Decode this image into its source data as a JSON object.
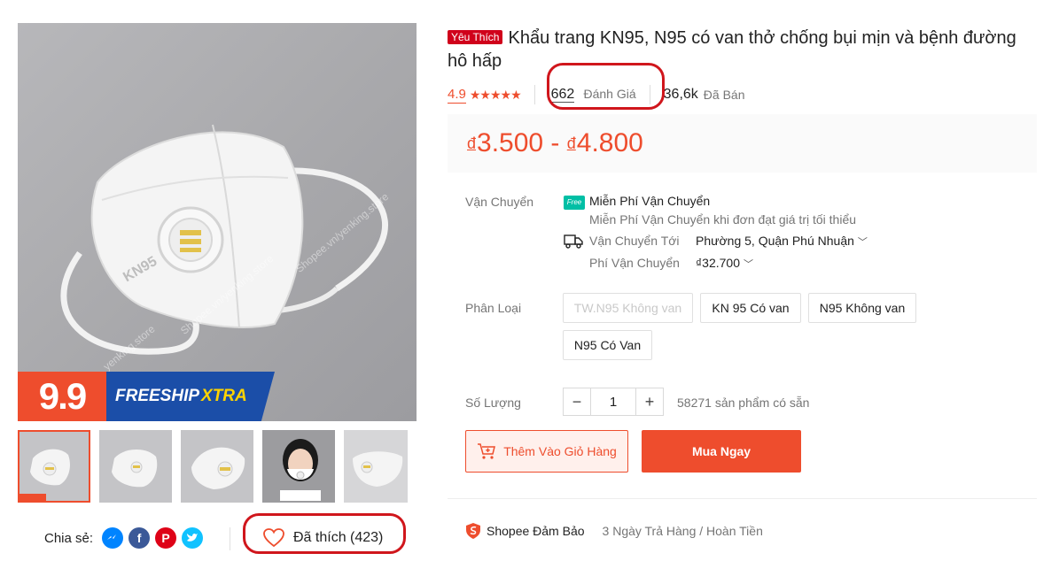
{
  "gallery": {
    "watermark": "Shopee.vn/yenking.store",
    "watermark_2": "yenking.store",
    "mask_text": "KN95",
    "promo": {
      "big": "9.9",
      "freeship": "FREESHIP",
      "xtra": "XTRA"
    },
    "thumbnails": [
      "thumb-1",
      "thumb-2",
      "thumb-3",
      "thumb-4",
      "thumb-5"
    ]
  },
  "share": {
    "label": "Chia sẻ:",
    "icons": [
      "messenger-icon",
      "facebook-icon",
      "pinterest-icon",
      "twitter-icon"
    ]
  },
  "like": {
    "label": "Đã thích (423)"
  },
  "product": {
    "badge": "Yêu Thích",
    "title": "Khẩu trang KN95, N95 có van thở chống bụi mịn và bệnh đường hô hấp",
    "rating": "4.9",
    "stars": "★★★★★",
    "review_count": "662",
    "review_label": "Đánh Giá",
    "sold_count": "36,6k",
    "sold_label": "Đã Bán",
    "price_currency": "đ",
    "price_min": "3.500",
    "price_dash": " - ",
    "price_max": "4.800"
  },
  "shipping": {
    "label": "Vận Chuyển",
    "free_badge": "Free",
    "free_title": "Miễn Phí Vận Chuyển",
    "free_sub": "Miễn Phí Vận Chuyển khi đơn đạt giá trị tối thiểu",
    "to_label": "Vận Chuyển Tới",
    "to_value": "Phường 5, Quận Phú Nhuận",
    "fee_label": "Phí Vận Chuyển",
    "fee_value": "₫32.700"
  },
  "variants": {
    "label": "Phân Loại",
    "options": [
      {
        "label": "TW.N95 Không van",
        "disabled": true
      },
      {
        "label": "KN 95 Có van",
        "disabled": false
      },
      {
        "label": "N95 Không van",
        "disabled": false
      },
      {
        "label": "N95 Có Van",
        "disabled": false
      }
    ]
  },
  "quantity": {
    "label": "Số Lượng",
    "minus": "−",
    "value": "1",
    "plus": "+",
    "stock": "58271 sản phẩm có sẵn"
  },
  "actions": {
    "add_to_cart": "Thêm Vào Giỏ Hàng",
    "buy_now": "Mua Ngay"
  },
  "guarantee": {
    "label": "Shopee Đảm Bảo",
    "text": "3 Ngày Trả Hàng / Hoàn Tiền"
  },
  "colors": {
    "accent": "#ee4d2d",
    "annotation": "#d0161c",
    "free_badge": "#00bfa5"
  }
}
